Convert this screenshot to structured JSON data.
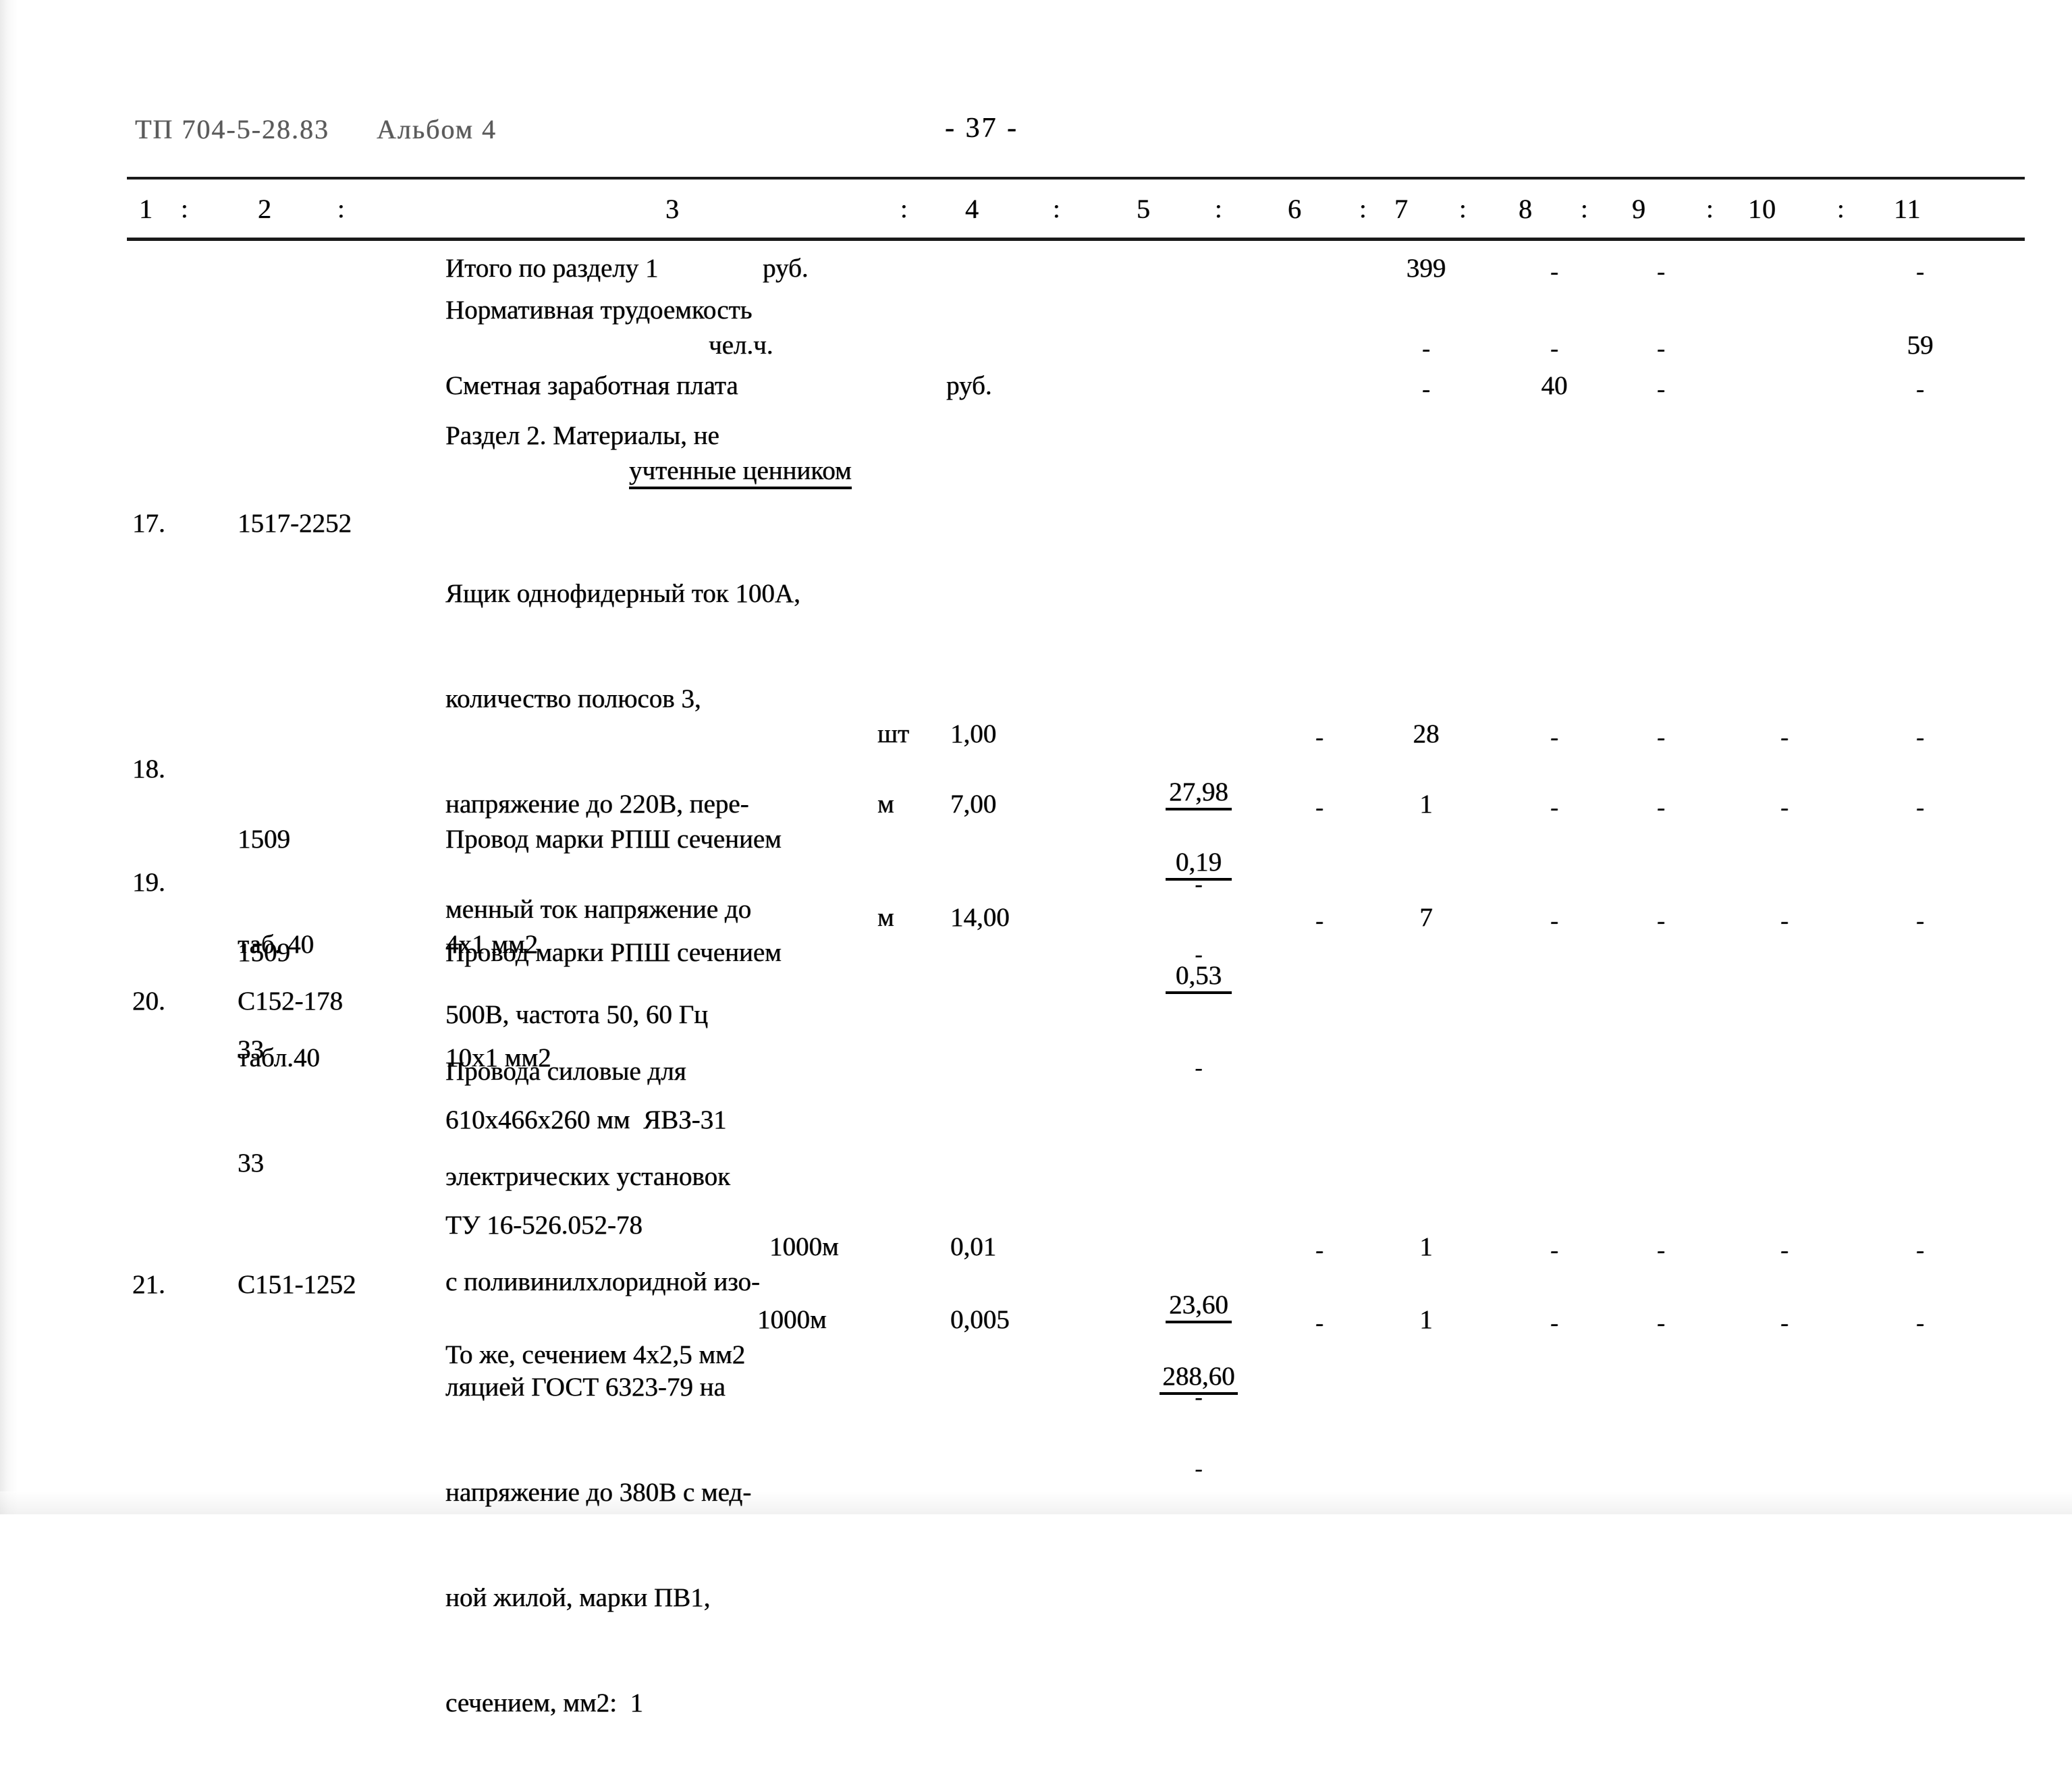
{
  "header": {
    "doc_code": "ТП 704-5-28.83",
    "album": "Альбом 4",
    "page_number": "- 37 -"
  },
  "column_headers": {
    "labels": [
      "1",
      "2",
      "3",
      "4",
      "5",
      "6",
      "7",
      "8",
      "9",
      "10",
      "11"
    ],
    "separator": ":"
  },
  "summary_rows": [
    {
      "desc": "Итого по разделу 1",
      "unit": "руб.",
      "c5": "",
      "c6": "",
      "c7": "399",
      "c8": "-",
      "c9": "-",
      "c10": "",
      "c11": "-"
    },
    {
      "desc": "Нормативная трудоемкость",
      "desc2": "чел.ч.",
      "unit": "",
      "c5": "",
      "c6": "",
      "c7": "-",
      "c8": "-",
      "c9": "-",
      "c10": "",
      "c11": "59"
    },
    {
      "desc": "Сметная заработная плата",
      "unit": "руб.",
      "c5": "",
      "c6": "",
      "c7": "-",
      "c8": "40",
      "c9": "-",
      "c10": "",
      "c11": "-"
    }
  ],
  "section": {
    "line1": "Раздел 2. Материалы, не",
    "line2": "учтенные ценником"
  },
  "rows": [
    {
      "num": "17.",
      "code": "1517-2252",
      "desc_lines": [
        "Ящик однофидерный ток 100А,",
        "количество полюсов 3,",
        "напряжение до 220В, пере-",
        "менный ток напряжение до",
        "500В, частота 50, 60 Гц",
        "610х466х260 мм  ЯВЗ-31",
        "ТУ 16-526.052-78"
      ],
      "unit": "шт",
      "qty": "1,00",
      "c5_top": "27,98",
      "c5_bottom": "-",
      "c6": "-",
      "c7": "28",
      "c8": "-",
      "c9": "-",
      "c10": "-",
      "c11": "-"
    },
    {
      "num": "18.",
      "code_lines": [
        "1509",
        "таб. 40",
        "33"
      ],
      "desc_lines": [
        "Провод марки РПШ сечением",
        "4х1 мм2"
      ],
      "unit": "м",
      "qty": "7,00",
      "c5_top": "0,19",
      "c5_bottom": "-",
      "c6": "-",
      "c7": "1",
      "c8": "-",
      "c9": "-",
      "c10": "-",
      "c11": "-"
    },
    {
      "num": "19.",
      "code_lines": [
        "1509",
        "табл.40",
        "33"
      ],
      "desc_lines": [
        "Провод марки РПШ сечением",
        "10х1 мм2"
      ],
      "unit": "м",
      "qty": "14,00",
      "c5_top": "0,53",
      "c5_bottom": "-",
      "c6": "-",
      "c7": "7",
      "c8": "-",
      "c9": "-",
      "c10": "-",
      "c11": "-"
    },
    {
      "num": "20.",
      "code": "С152-178",
      "desc_lines": [
        "Провода силовые для",
        "электрических установок",
        "с поливинилхлоридной изо-",
        "ляцией ГОСТ 6323-79 на",
        "напряжение до 380В с мед-",
        "ной жилой, марки ПВ1,",
        "сечением, мм2:  1"
      ],
      "unit": "1000м",
      "qty": "0,01",
      "c5_top": "23,60",
      "c5_bottom": "-",
      "c6": "-",
      "c7": "1",
      "c8": "-",
      "c9": "-",
      "c10": "-",
      "c11": "-"
    },
    {
      "num": "21.",
      "code": "С151-1252",
      "desc_lines": [
        "То же, сечением 4х2,5 мм2",
        "1000м"
      ],
      "unit": "",
      "qty": "0,005",
      "c5_top": "288,60",
      "c5_bottom": "-",
      "c6": "-",
      "c7": "1",
      "c8": "-",
      "c9": "-",
      "c10": "-",
      "c11": "-"
    }
  ]
}
